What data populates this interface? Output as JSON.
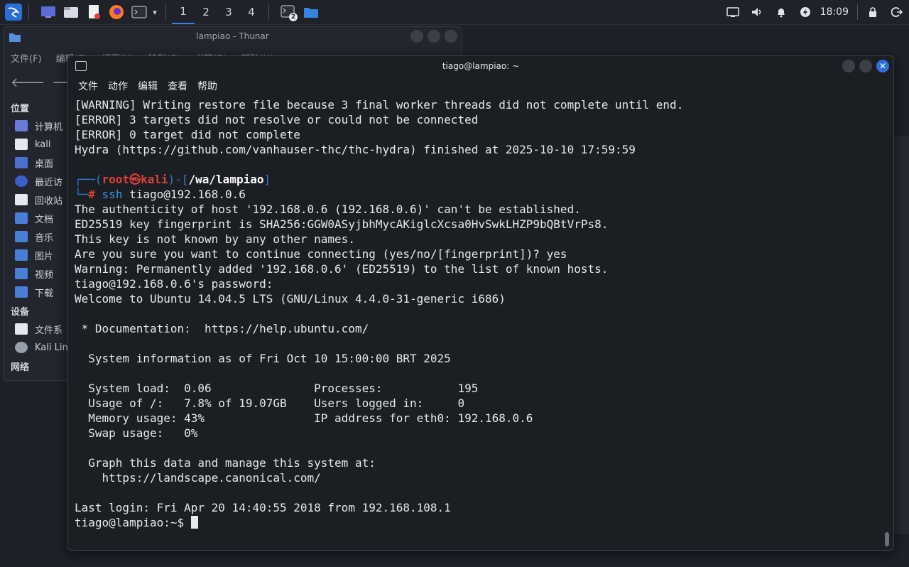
{
  "panel": {
    "workspaces": [
      "1",
      "2",
      "3",
      "4"
    ],
    "clock": "18:09",
    "terminal_badge": "2"
  },
  "thunar": {
    "title": "lampiao - Thunar",
    "menu": [
      "文件(F)",
      "编辑(E)",
      "视图(V)",
      "转到(G)",
      "书签(B)",
      "帮助(H)"
    ],
    "places_header": "位置",
    "places": [
      "计算机",
      "kali",
      "桌面",
      "最近访",
      "回收站",
      "文档",
      "音乐",
      "图片",
      "视频",
      "下载"
    ],
    "devices_header": "设备",
    "devices": [
      "文件系",
      "Kali Linux"
    ],
    "network_header": "网络"
  },
  "terminal": {
    "title": "tiago@lampiao: ~",
    "menu": [
      "文件",
      "动作",
      "编辑",
      "查看",
      "帮助"
    ],
    "lines_top": [
      "[WARNING] Writing restore file because 3 final worker threads did not complete until end.",
      "[ERROR] 3 targets did not resolve or could not be connected",
      "[ERROR] 0 target did not complete",
      "Hydra (https://github.com/vanhauser-thc/thc-hydra) finished at 2025-10-10 17:59:59"
    ],
    "prompt": {
      "user": "root",
      "at": "㉿",
      "host": "kali",
      "path": "/wa/lampiao",
      "hash": "#",
      "command": "ssh",
      "args": " tiago@192.168.0.6"
    },
    "lines_bottom": [
      "The authenticity of host '192.168.0.6 (192.168.0.6)' can't be established.",
      "ED25519 key fingerprint is SHA256:GGW0ASyjbhMycAKiglcXcsa0HvSwkLHZP9bQBtVrPs8.",
      "This key is not known by any other names.",
      "Are you sure you want to continue connecting (yes/no/[fingerprint])? yes",
      "Warning: Permanently added '192.168.0.6' (ED25519) to the list of known hosts.",
      "tiago@192.168.0.6's password:",
      "Welcome to Ubuntu 14.04.5 LTS (GNU/Linux 4.4.0-31-generic i686)",
      "",
      " * Documentation:  https://help.ubuntu.com/",
      "",
      "  System information as of Fri Oct 10 15:00:00 BRT 2025",
      "",
      "  System load:  0.06               Processes:           195",
      "  Usage of /:   7.8% of 19.07GB    Users logged in:     0",
      "  Memory usage: 43%                IP address for eth0: 192.168.0.6",
      "  Swap usage:   0%",
      "",
      "  Graph this data and manage this system at:",
      "    https://landscape.canonical.com/",
      "",
      "Last login: Fri Apr 20 14:40:55 2018 from 192.168.108.1"
    ],
    "final_prompt": "tiago@lampiao:~$ "
  }
}
